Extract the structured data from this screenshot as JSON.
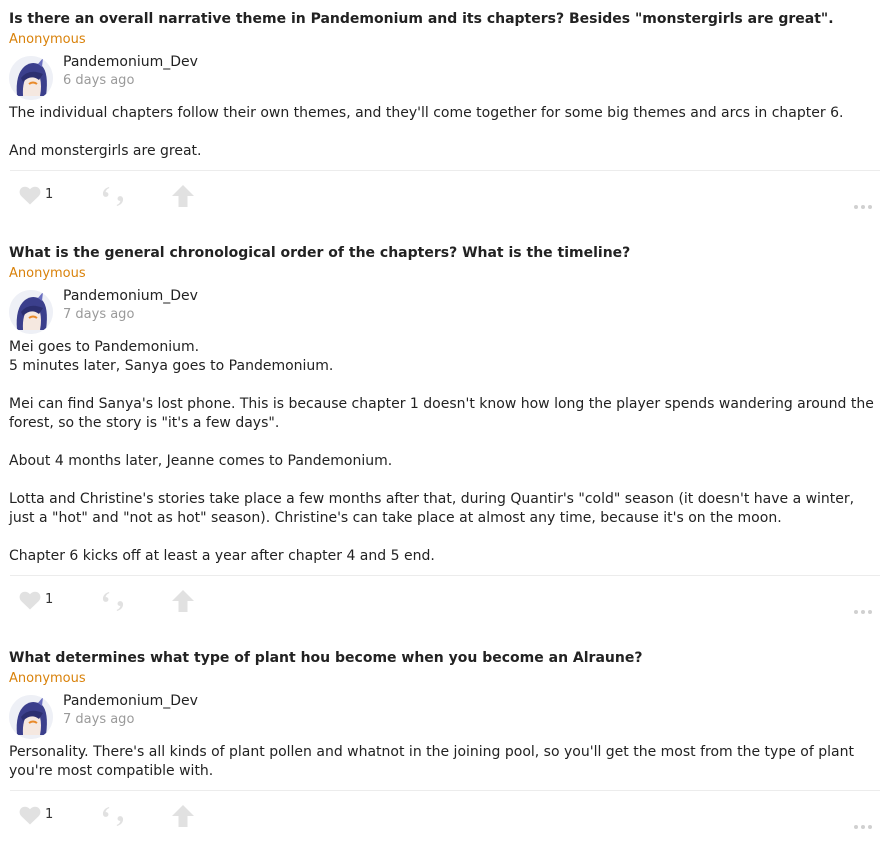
{
  "colors": {
    "asker": "#d9820b",
    "icon": "#e1e1e1",
    "meta": "#9a9a9a",
    "text": "#222222"
  },
  "icons": [
    "heart-icon",
    "quote-icon",
    "share-arrow-icon",
    "more-dots-icon",
    "avatar"
  ],
  "posts": [
    {
      "question": "Is there an overall narrative theme in Pandemonium and its chapters? Besides \"monstergirls are great\".",
      "asker": "Anonymous",
      "author": "Pandemonium_Dev",
      "time": "6 days ago",
      "paragraphs": [
        "The individual chapters follow their own themes, and they'll come together for some big themes and arcs in chapter 6.",
        "And monstergirls are great."
      ],
      "likes": "1"
    },
    {
      "question": "What is the general chronological order of the chapters? What is the timeline?",
      "asker": "Anonymous",
      "author": "Pandemonium_Dev",
      "time": "7 days ago",
      "paragraphs": [
        "Mei goes to Pandemonium.\n5 minutes later, Sanya goes to Pandemonium.",
        "Mei can find Sanya's lost phone. This is because chapter 1 doesn't know how long the player spends wandering around the forest, so the story is \"it's a few days\".",
        "About 4 months later, Jeanne comes to Pandemonium.",
        "Lotta and Christine's stories take place a few months after that, during Quantir's \"cold\" season (it doesn't have a winter, just a \"hot\" and \"not as hot\" season). Christine's can take place at almost any time, because it's on the moon.",
        "Chapter 6 kicks off at least a year after chapter 4 and 5 end."
      ],
      "likes": "1"
    },
    {
      "question": "What determines what type of plant hou become when you become an Alraune?",
      "asker": "Anonymous",
      "author": "Pandemonium_Dev",
      "time": "7 days ago",
      "paragraphs": [
        "Personality. There's all kinds of plant pollen and whatnot in the joining pool, so you'll get the most from the type of plant you're most compatible with."
      ],
      "likes": "1"
    }
  ]
}
